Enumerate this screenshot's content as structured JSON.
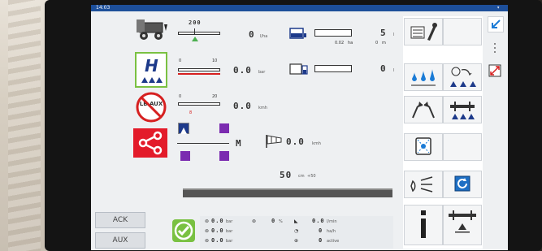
{
  "status": {
    "time": "14:03",
    "indicator": "▾"
  },
  "gauges": {
    "rate_target": "200",
    "rate_value": "0",
    "rate_unit": "l/ha",
    "pressure_scale_min": "0",
    "pressure_scale_max": "10",
    "pressure_value": "0.0",
    "pressure_unit": "bar",
    "speed_scale_min": "0",
    "speed_scale_max": "20",
    "speed_scale_mark": "8",
    "speed_value": "0.0",
    "speed_unit": "kmh"
  },
  "tank": {
    "count": "5",
    "count_suffix": "l",
    "area": "0.02",
    "area_unit": "ha",
    "distance": "0",
    "distance_unit": "m",
    "second_count": "0",
    "second_suffix": "l"
  },
  "boom": {
    "mode": "M",
    "wind_value": "0.0",
    "wind_unit": "kmh",
    "height_value": "50",
    "height_unit": "cm",
    "height_offset": "+50"
  },
  "left_buttons": {
    "ack": "ACK",
    "aux": "AUX"
  },
  "lb_aux_icon_text": "LB AUX",
  "footer": {
    "col1": [
      {
        "value": "0.0",
        "unit": "bar"
      },
      {
        "value": "0.0",
        "unit": "bar"
      },
      {
        "value": "0.0",
        "unit": "bar"
      }
    ],
    "col2": {
      "value": "0",
      "unit": "%"
    },
    "col3": [
      {
        "value": "0.0",
        "unit": "l/min"
      },
      {
        "value": "0",
        "unit": "ha/h"
      },
      {
        "value": "0",
        "unit": "active"
      }
    ]
  },
  "colors": {
    "accent_green": "#7ac142",
    "accent_blue": "#1d4f9a",
    "accent_red": "#d62020",
    "section_purple": "#7b2bb0"
  }
}
